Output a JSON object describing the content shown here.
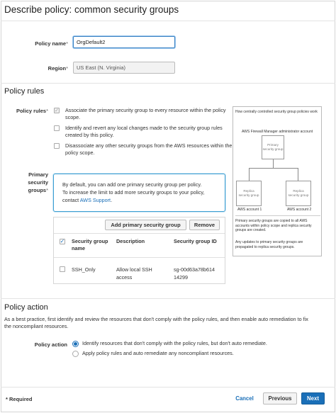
{
  "header": {
    "title": "Describe policy: common security groups"
  },
  "policy_name": {
    "label": "Policy name",
    "req_mark": "*",
    "value": "OrgDefault2"
  },
  "region": {
    "label": "Region",
    "req_mark": "*",
    "value": "US East (N. Virginia)"
  },
  "policy_rules": {
    "section_title": "Policy rules",
    "label": "Policy rules",
    "req_mark": "*",
    "options": [
      {
        "text": "Associate the primary security group to every resource within the policy scope.",
        "checked": true
      },
      {
        "text": "Identify and revert any local changes made to the security group rules created by this policy.",
        "checked": false
      },
      {
        "text": "Disassociate any other security groups from the AWS resources within the policy scope.",
        "checked": false
      }
    ]
  },
  "primary_sg": {
    "label_line1": "Primary",
    "label_line2": "security",
    "label_line3": "groups",
    "req_mark": "*",
    "info_line1": "By default, you can add one primary security group per policy.",
    "info_line2": "To increase the limit to add more security groups to your policy,",
    "info_line3_prefix": "contact ",
    "info_link": "AWS Support",
    "info_line3_suffix": ".",
    "add_button": "Add primary security group",
    "remove_button": "Remove",
    "columns": {
      "name_1": "Security group",
      "name_2": "name",
      "description": "Description",
      "id": "Security group ID"
    },
    "rows": [
      {
        "name": "SSH_Only",
        "description_1": "Allow local SSH",
        "description_2": "access",
        "id_1": "sg-00d63a78b614",
        "id_2": "14299"
      }
    ]
  },
  "diagram": {
    "caption": "How centrally controlled security group policies work",
    "admin_account": "AWS Firewall Manager administrator account",
    "primary_box_1": "Primary",
    "primary_box_2": "security group",
    "replica_left_1": "Replica",
    "replica_left_2": "security group",
    "replica_right_1": "Replica",
    "replica_right_2": "security group",
    "account_1": "AWS account 1",
    "account_2": "AWS account 2",
    "note_1": "Primary security groups are copied to all AWS accounts within policy scope and replica security groups are created.",
    "note_2": "Any updates to primary security groups are propagated to replica security groups."
  },
  "policy_action": {
    "section_title": "Policy action",
    "description_1": "As a best practice, first identify and review the resources that don't comply with the policy rules, and then enable auto remediation to fix",
    "description_2": "the noncompliant resources.",
    "label": "Policy action",
    "options": [
      {
        "text": "Identify resources that don't comply with the policy rules, but don't auto remediate.",
        "selected": true
      },
      {
        "text": "Apply policy rules and auto remediate any noncompliant resources.",
        "selected": false
      }
    ]
  },
  "footer": {
    "required_note": "* Required",
    "cancel": "Cancel",
    "previous": "Previous",
    "next": "Next"
  },
  "colors": {
    "accent": "#1a6fb8",
    "next_bg": "#1a6fb8",
    "info_border": "#3d9fd3"
  }
}
